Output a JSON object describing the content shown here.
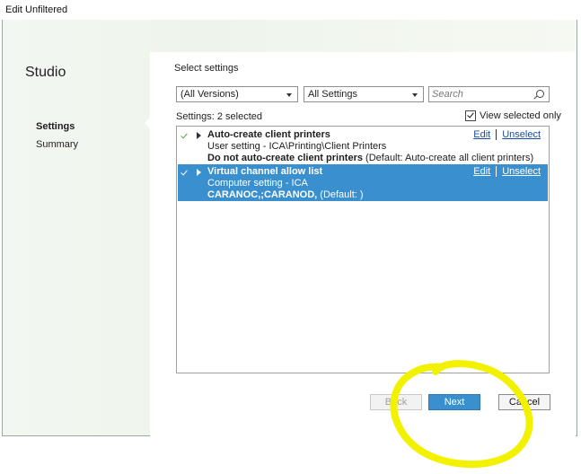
{
  "window": {
    "title": "Edit Unfiltered"
  },
  "sidebar": {
    "title": "Studio",
    "items": [
      {
        "label": "Settings",
        "active": true
      },
      {
        "label": "Summary",
        "active": false
      }
    ]
  },
  "main": {
    "heading": "Select settings",
    "version_dropdown": {
      "selected": "(All Versions)"
    },
    "category_dropdown": {
      "selected": "All Settings"
    },
    "search": {
      "placeholder": "Search",
      "value": ""
    },
    "settings_count": "Settings: 2 selected",
    "view_selected_only": {
      "label": "View selected only",
      "checked": true
    }
  },
  "list": {
    "rows": [
      {
        "name": "Auto-create client printers",
        "path": "User setting - ICA\\Printing\\Client Printers",
        "value_bold": "Do not auto-create client printers",
        "value_rest": " (Default: Auto-create all client printers)",
        "edit": "Edit",
        "unselect": "Unselect",
        "selected": false
      },
      {
        "name": "Virtual channel allow list",
        "path": "Computer setting - ICA",
        "value_bold": "CARANOC,;CARANOD,",
        "value_rest": " (Default: )",
        "edit": "Edit",
        "unselect": "Unselect",
        "selected": true
      }
    ]
  },
  "buttons": {
    "back": "Back",
    "next": "Next",
    "cancel": "Cancel"
  },
  "colors": {
    "accent": "#3a8fcf",
    "annotation": "#f2f200",
    "check_green": "#5aa13a"
  }
}
